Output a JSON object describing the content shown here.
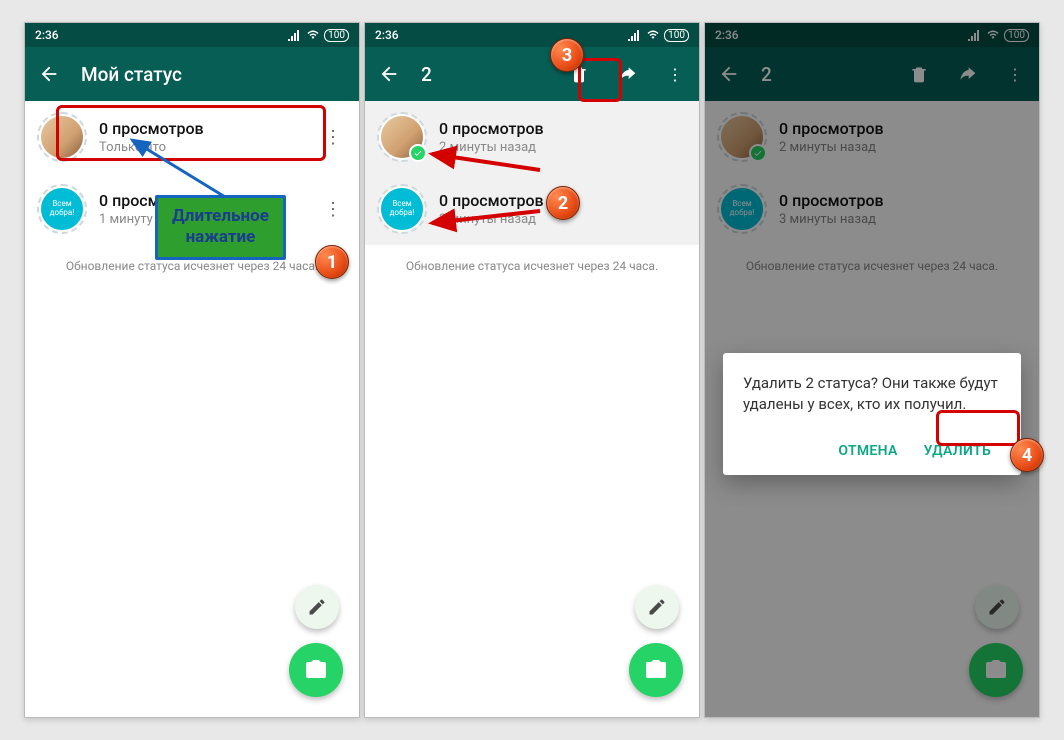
{
  "statusbar": {
    "time": "2:36",
    "battery": "100"
  },
  "screen1": {
    "title": "Мой статус",
    "rows": [
      {
        "title": "0 просмотров",
        "sub": "Только что",
        "avatar_text": ""
      },
      {
        "title": "0 просмотров",
        "sub": "1 минуту назад",
        "avatar_text": "Всем добра!"
      }
    ],
    "footer": "Обновление статуса исчезнет через 24 часа."
  },
  "screen2": {
    "selected_count": "2",
    "rows": [
      {
        "title": "0 просмотров",
        "sub": "2 минуты назад",
        "avatar_text": ""
      },
      {
        "title": "0 просмотров",
        "sub": "3 минуты назад",
        "avatar_text": "Всем добра!"
      }
    ],
    "footer": "Обновление статуса исчезнет через 24 часа."
  },
  "screen3": {
    "selected_count": "2",
    "rows": [
      {
        "title": "0 просмотров",
        "sub": "2 минуты назад",
        "avatar_text": ""
      },
      {
        "title": "0 просмотров",
        "sub": "3 минуты назад",
        "avatar_text": "Всем добра!"
      }
    ],
    "footer": "Обновление статуса исчезнет через 24 часа.",
    "dialog": {
      "message": "Удалить 2 статуса? Они также будут удалены у всех, кто их получил.",
      "cancel": "ОТМЕНА",
      "confirm": "УДАЛИТЬ"
    }
  },
  "callouts": {
    "n1": "1",
    "n2": "2",
    "n3": "3",
    "n4": "4",
    "longpress": "Длительное\nнажатие"
  }
}
